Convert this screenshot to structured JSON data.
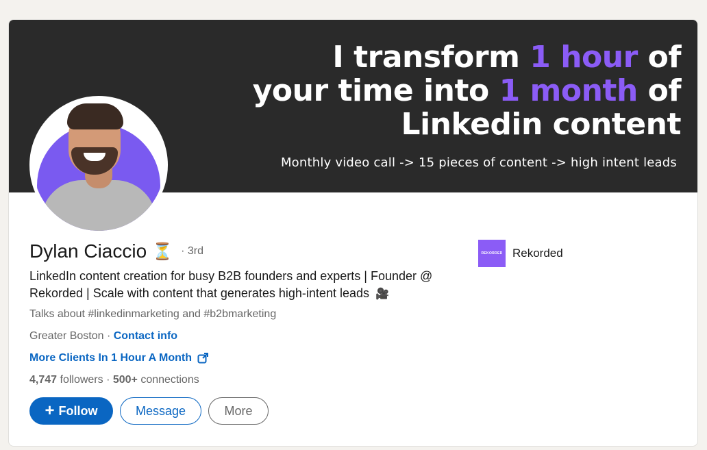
{
  "banner": {
    "line1_a": "I transform ",
    "line1_hl": "1 hour",
    "line1_b": " of",
    "line2_a": "your time into ",
    "line2_hl": "1 month",
    "line2_b": " of",
    "line3": "Linkedin content",
    "subline": "Monthly video call -> 15 pieces of content -> high intent leads"
  },
  "profile": {
    "name": "Dylan Ciaccio",
    "name_emoji": "⏳",
    "degree": "· 3rd",
    "headline": "LinkedIn content creation for busy B2B founders and experts | Founder @ Rekorded | Scale with content that generates high-intent leads",
    "headline_emoji": "🎥",
    "talks_about": "Talks about #linkedinmarketing and #b2bmarketing",
    "location": "Greater Boston",
    "location_sep": " · ",
    "contact_info": "Contact info",
    "website_label": "More Clients In 1 Hour A Month",
    "followers_count": "4,747",
    "followers_label": " followers",
    "connections_sep": " · ",
    "connections_count": "500+",
    "connections_label": " connections"
  },
  "company": {
    "logo_text": "REKORDED",
    "name": "Rekorded"
  },
  "actions": {
    "follow_plus": "+",
    "follow": "Follow",
    "message": "Message",
    "more": "More"
  },
  "colors": {
    "accent": "#0a66c2",
    "banner_bg": "#2a2a2a",
    "brand_purple": "#8b5cf6"
  },
  "icons": [
    "hourglass-icon",
    "video-camera-icon",
    "external-link-icon",
    "plus-icon"
  ]
}
